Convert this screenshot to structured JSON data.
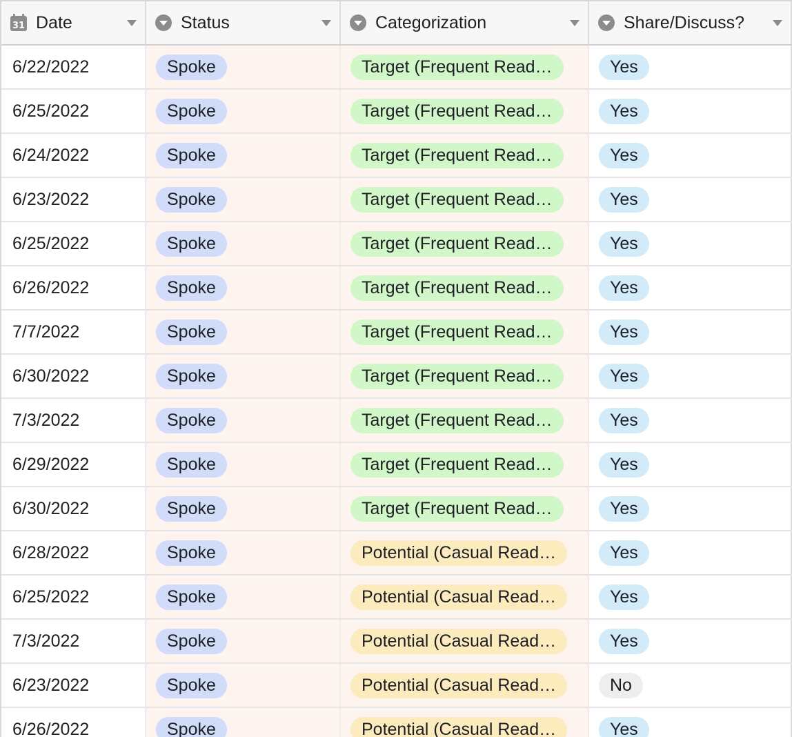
{
  "columns": [
    {
      "key": "date",
      "label": "Date",
      "icon": "calendar-icon"
    },
    {
      "key": "status",
      "label": "Status",
      "icon": "single-select-icon"
    },
    {
      "key": "categorization",
      "label": "Categorization",
      "icon": "single-select-icon"
    },
    {
      "key": "share",
      "label": "Share/Discuss?",
      "icon": "single-select-icon"
    }
  ],
  "calendar_icon_text": "31",
  "colors": {
    "status_pill": "#d1dcf9",
    "target_pill": "#d1f6c8",
    "potential_pill": "#fcebbd",
    "yes_pill": "#d1ebf9",
    "no_pill": "#eeeeee",
    "select_column_bg": "#fdf3ef"
  },
  "rows": [
    {
      "date": "6/22/2022",
      "status": "Spoke",
      "categorization": "Target (Frequent Read…",
      "cat_type": "target",
      "share": "Yes"
    },
    {
      "date": "6/25/2022",
      "status": "Spoke",
      "categorization": "Target (Frequent Read…",
      "cat_type": "target",
      "share": "Yes"
    },
    {
      "date": "6/24/2022",
      "status": "Spoke",
      "categorization": "Target (Frequent Read…",
      "cat_type": "target",
      "share": "Yes"
    },
    {
      "date": "6/23/2022",
      "status": "Spoke",
      "categorization": "Target (Frequent Read…",
      "cat_type": "target",
      "share": "Yes"
    },
    {
      "date": "6/25/2022",
      "status": "Spoke",
      "categorization": "Target (Frequent Read…",
      "cat_type": "target",
      "share": "Yes"
    },
    {
      "date": "6/26/2022",
      "status": "Spoke",
      "categorization": "Target (Frequent Read…",
      "cat_type": "target",
      "share": "Yes"
    },
    {
      "date": "7/7/2022",
      "status": "Spoke",
      "categorization": "Target (Frequent Read…",
      "cat_type": "target",
      "share": "Yes"
    },
    {
      "date": "6/30/2022",
      "status": "Spoke",
      "categorization": "Target (Frequent Read…",
      "cat_type": "target",
      "share": "Yes"
    },
    {
      "date": "7/3/2022",
      "status": "Spoke",
      "categorization": "Target (Frequent Read…",
      "cat_type": "target",
      "share": "Yes"
    },
    {
      "date": "6/29/2022",
      "status": "Spoke",
      "categorization": "Target (Frequent Read…",
      "cat_type": "target",
      "share": "Yes"
    },
    {
      "date": "6/30/2022",
      "status": "Spoke",
      "categorization": "Target (Frequent Read…",
      "cat_type": "target",
      "share": "Yes"
    },
    {
      "date": "6/28/2022",
      "status": "Spoke",
      "categorization": "Potential (Casual Read…",
      "cat_type": "potential",
      "share": "Yes"
    },
    {
      "date": "6/25/2022",
      "status": "Spoke",
      "categorization": "Potential (Casual Read…",
      "cat_type": "potential",
      "share": "Yes"
    },
    {
      "date": "7/3/2022",
      "status": "Spoke",
      "categorization": "Potential (Casual Read…",
      "cat_type": "potential",
      "share": "Yes"
    },
    {
      "date": "6/23/2022",
      "status": "Spoke",
      "categorization": "Potential (Casual Read…",
      "cat_type": "potential",
      "share": "No"
    },
    {
      "date": "6/26/2022",
      "status": "Spoke",
      "categorization": "Potential (Casual Read…",
      "cat_type": "potential",
      "share": "Yes"
    }
  ]
}
